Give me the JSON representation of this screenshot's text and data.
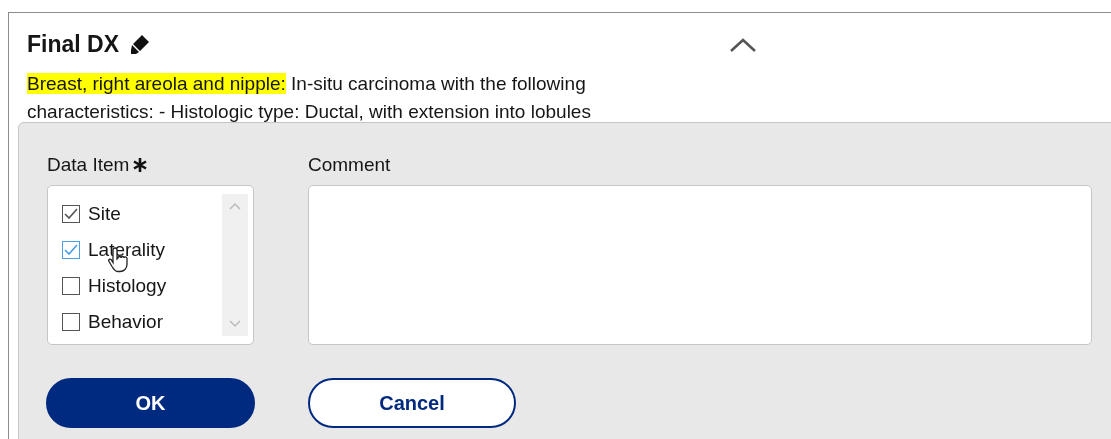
{
  "section": {
    "title": "Final DX",
    "expanded": true,
    "highlight": "Breast, right areola and nipple:",
    "text": "In-situ carcinoma with the following",
    "text_line_2": "characteristics: - Histologic type: Ductal, with extension into lobules"
  },
  "popup": {
    "data_item_label": "Data Item",
    "required": true,
    "items": [
      {
        "label": "Site",
        "checked": true,
        "hovered": false
      },
      {
        "label": "Laterality",
        "checked": true,
        "hovered": true
      },
      {
        "label": "Histology",
        "checked": false,
        "hovered": false
      },
      {
        "label": "Behavior",
        "checked": false,
        "hovered": false
      }
    ],
    "comment_label": "Comment",
    "buttons": [
      {
        "label": "OK",
        "kind": "primary"
      },
      {
        "label": "Cancel",
        "kind": "secondary"
      }
    ]
  }
}
